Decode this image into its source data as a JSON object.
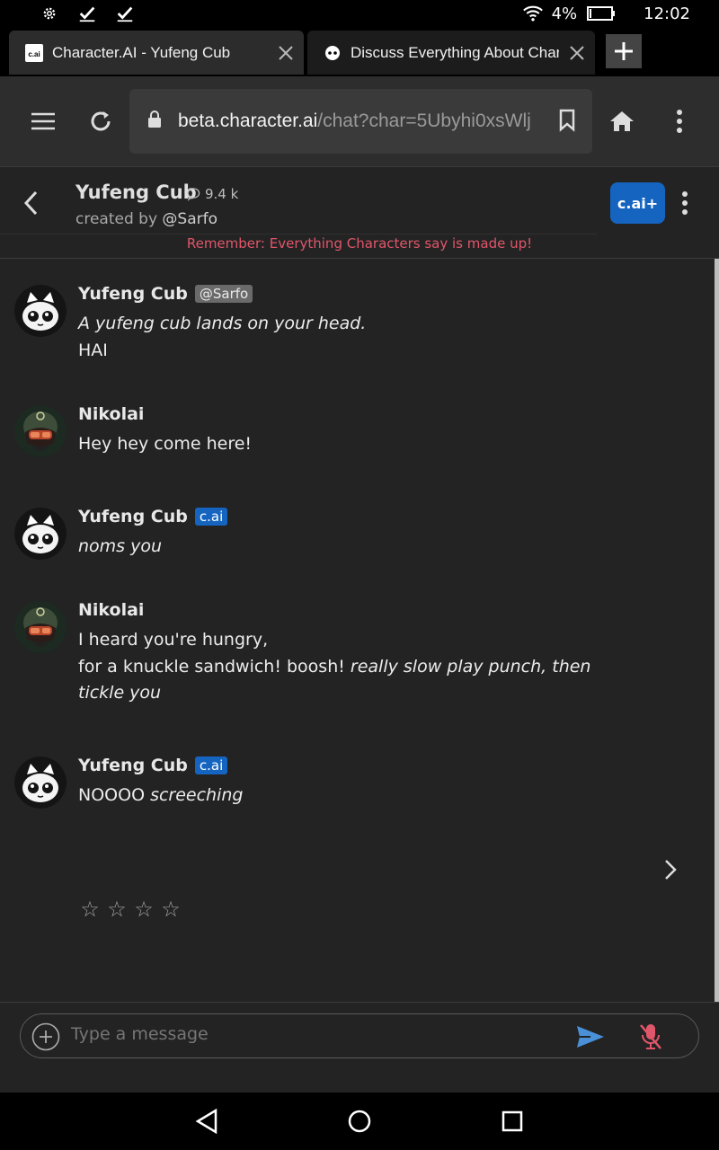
{
  "status_bar": {
    "battery_percent": "4%",
    "time": "12:02",
    "icons": [
      "gear-icon",
      "check-icon",
      "check-icon",
      "wifi-icon",
      "battery-icon"
    ]
  },
  "tabs": [
    {
      "title": "Character.AI - Yufeng Cub",
      "favicon": "c.ai"
    },
    {
      "title": "Discuss Everything About Character",
      "favicon": "discord-icon"
    }
  ],
  "toolbar": {
    "url_host": "beta.character.ai",
    "url_path": "/chat?char=5Ubyhi0xsWlj"
  },
  "chat_header": {
    "name": "Yufeng Cub",
    "interactions": "9.4 k",
    "created_by_prefix": "created by ",
    "creator": "@Sarfo",
    "plus_badge": "c.ai+",
    "disclaimer": "Remember: Everything Characters say is made up!"
  },
  "messages": [
    {
      "author": "Yufeng Cub",
      "tag": "@Sarfo",
      "tag_type": "user",
      "lines": [
        [
          {
            "text": "A yufeng cub lands on your head.",
            "italic": true
          }
        ],
        [
          {
            "text": "HAI",
            "italic": false
          }
        ]
      ]
    },
    {
      "author": "Nikolai",
      "tag": "",
      "tag_type": "",
      "lines": [
        [
          {
            "text": "Hey hey come here!",
            "italic": false
          }
        ]
      ]
    },
    {
      "author": "Yufeng Cub",
      "tag": "c.ai",
      "tag_type": "cai",
      "lines": [
        [
          {
            "text": "noms you",
            "italic": true
          }
        ]
      ]
    },
    {
      "author": "Nikolai",
      "tag": "",
      "tag_type": "",
      "lines": [
        [
          {
            "text": "I heard you're hungry,",
            "italic": false
          }
        ],
        [
          {
            "text": "for a knuckle sandwich! boosh! ",
            "italic": false
          },
          {
            "text": "really slow play punch, then tickle you",
            "italic": true
          }
        ]
      ]
    },
    {
      "author": "Yufeng Cub",
      "tag": "c.ai",
      "tag_type": "cai",
      "lines": [
        [
          {
            "text": "NOOOO ",
            "italic": false
          },
          {
            "text": "screeching",
            "italic": true
          }
        ]
      ]
    }
  ],
  "rating": {
    "stars": [
      "☆",
      "☆",
      "☆",
      "☆"
    ],
    "value": 0,
    "max": 4
  },
  "composer": {
    "placeholder": "Type a message"
  },
  "colors": {
    "accent": "#1565c0",
    "send": "#4a90d9",
    "mic_muted": "#e0566a",
    "disclaimer": "#e0566a"
  }
}
